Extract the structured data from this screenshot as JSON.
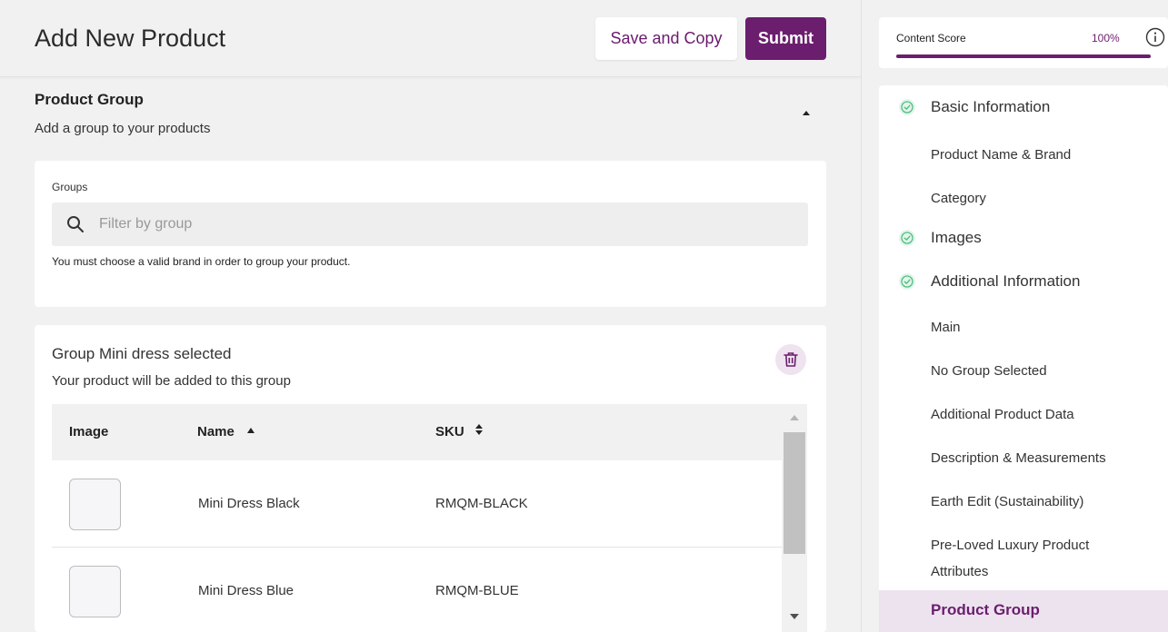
{
  "header": {
    "title": "Add New Product",
    "save_copy_label": "Save and Copy",
    "submit_label": "Submit"
  },
  "section": {
    "title": "Product Group",
    "subtitle": "Add a group to your products"
  },
  "groups": {
    "label": "Groups",
    "search_placeholder": "Filter by group",
    "search_value": "",
    "hint": "You must choose a valid brand in order to group your product."
  },
  "selected_group": {
    "title": "Group Mini dress selected",
    "subtitle": "Your product will be added to this group",
    "table": {
      "headers": [
        "Image",
        "Name",
        "SKU"
      ],
      "rows": [
        {
          "name": "Mini Dress Black",
          "sku": "RMQM-BLACK"
        },
        {
          "name": "Mini Dress Blue",
          "sku": "RMQM-BLUE"
        }
      ]
    }
  },
  "sidebar": {
    "score_label": "Content Score",
    "score_value": "100%",
    "score_percent": 100,
    "items": [
      {
        "label": "Basic Information",
        "complete": true
      },
      {
        "label": "Product Name & Brand"
      },
      {
        "label": "Category"
      },
      {
        "label": "Images",
        "complete": true
      },
      {
        "label": "Additional Information",
        "complete": true
      },
      {
        "label": "Main"
      },
      {
        "label": "No Group Selected"
      },
      {
        "label": "Additional Product Data"
      },
      {
        "label": "Description & Measurements"
      },
      {
        "label": "Earth Edit (Sustainability)"
      },
      {
        "label": "Pre-Loved Luxury Product Attributes"
      },
      {
        "label": "Product Group",
        "active": true
      }
    ]
  },
  "colors": {
    "brand": "#6b1e6e",
    "check": "#4fbf7f",
    "active_bg": "#ede3ef"
  }
}
